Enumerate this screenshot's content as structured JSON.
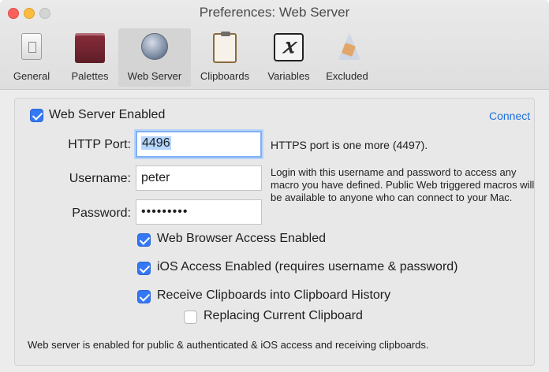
{
  "window": {
    "title": "Preferences: Web Server"
  },
  "toolbar": {
    "items": [
      {
        "label": "General",
        "icon": "general-switch-icon"
      },
      {
        "label": "Palettes",
        "icon": "palette-icon"
      },
      {
        "label": "Web Server",
        "icon": "globe-icon",
        "selected": true
      },
      {
        "label": "Clipboards",
        "icon": "clipboard-icon"
      },
      {
        "label": "Variables",
        "icon": "variable-x-icon",
        "glyph": "𝑥"
      },
      {
        "label": "Excluded",
        "icon": "excluded-app-icon"
      }
    ]
  },
  "web_server": {
    "enabled_label": "Web Server Enabled",
    "connect_link": "Connect",
    "http_port": {
      "label": "HTTP Port:",
      "value": "4496"
    },
    "https_note": "HTTPS port is one more (4497).",
    "username": {
      "label": "Username:",
      "value": "peter"
    },
    "password": {
      "label": "Password:",
      "value": "•••••••••"
    },
    "login_note": "Login with this username and password to access any macro you have defined. Public Web triggered macros will be available to anyone who can connect to your Mac.",
    "options": {
      "web_browser": "Web Browser Access Enabled",
      "ios": "iOS Access Enabled (requires username & password)",
      "clipboards": "Receive Clipboards into Clipboard History",
      "replace": "Replacing Current Clipboard"
    },
    "status": "Web server is enabled for public & authenticated & iOS access and receiving clipboards."
  },
  "colors": {
    "accent": "#3478f6",
    "link": "#1f6fe0"
  }
}
